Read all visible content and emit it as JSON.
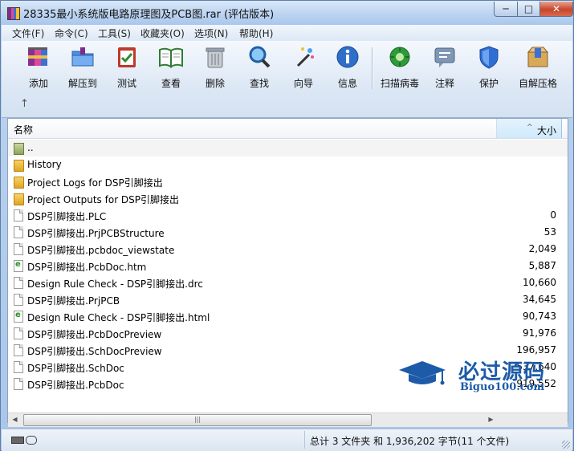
{
  "window": {
    "title": "28335最小系统版电路原理图及PCB图.rar (评估版本)",
    "minimize": "─",
    "maximize": "□",
    "close": "✕"
  },
  "menu": [
    "文件(F)",
    "命令(C)",
    "工具(S)",
    "收藏夹(O)",
    "选项(N)",
    "帮助(H)"
  ],
  "toolbar": [
    {
      "label": "添加",
      "icon": "add-archive-icon"
    },
    {
      "label": "解压到",
      "icon": "extract-folder-icon"
    },
    {
      "label": "测试",
      "icon": "test-clipboard-icon"
    },
    {
      "label": "查看",
      "icon": "view-book-icon"
    },
    {
      "label": "删除",
      "icon": "trash-icon"
    },
    {
      "label": "查找",
      "icon": "magnifier-icon"
    },
    {
      "label": "向导",
      "icon": "wizard-wand-icon"
    },
    {
      "label": "信息",
      "icon": "info-icon"
    },
    {
      "label": "扫描病毒",
      "icon": "virus-scan-icon"
    },
    {
      "label": "注释",
      "icon": "comment-icon"
    },
    {
      "label": "保护",
      "icon": "shield-icon"
    },
    {
      "label": "自解压格",
      "icon": "sfx-box-icon"
    }
  ],
  "up_arrow": "↑",
  "columns": {
    "name": "名称",
    "size": "大小",
    "sort": "^"
  },
  "files": [
    {
      "name": "..",
      "size": "",
      "type": "parent"
    },
    {
      "name": "History",
      "size": "",
      "type": "folder"
    },
    {
      "name": "Project Logs for DSP引脚接出",
      "size": "",
      "type": "folder"
    },
    {
      "name": "Project Outputs for DSP引脚接出",
      "size": "",
      "type": "folder"
    },
    {
      "name": "DSP引脚接出.PLC",
      "size": "0",
      "type": "doc"
    },
    {
      "name": "DSP引脚接出.PrjPCBStructure",
      "size": "53",
      "type": "doc"
    },
    {
      "name": "DSP引脚接出.pcbdoc_viewstate",
      "size": "2,049",
      "type": "doc"
    },
    {
      "name": "DSP引脚接出.PcbDoc.htm",
      "size": "5,887",
      "type": "html"
    },
    {
      "name": "Design Rule Check - DSP引脚接出.drc",
      "size": "10,660",
      "type": "doc"
    },
    {
      "name": "DSP引脚接出.PrjPCB",
      "size": "34,645",
      "type": "doc"
    },
    {
      "name": "Design Rule Check - DSP引脚接出.html",
      "size": "90,743",
      "type": "html"
    },
    {
      "name": "DSP引脚接出.PcbDocPreview",
      "size": "91,976",
      "type": "doc"
    },
    {
      "name": "DSP引脚接出.SchDocPreview",
      "size": "196,957",
      "type": "doc"
    },
    {
      "name": "DSP引脚接出.SchDoc",
      "size": "537,640",
      "type": "doc"
    },
    {
      "name": "DSP引脚接出.PcbDoc",
      "size": "919,552",
      "type": "doc"
    }
  ],
  "watermark": {
    "cn": "必过源码",
    "en": "Biguo100.com"
  },
  "scrollbar": {
    "left": "◀",
    "grip": "|||",
    "right": "▶"
  },
  "status": {
    "text": "总计 3 文件夹 和 1,936,202 字节(11 个文件)"
  }
}
